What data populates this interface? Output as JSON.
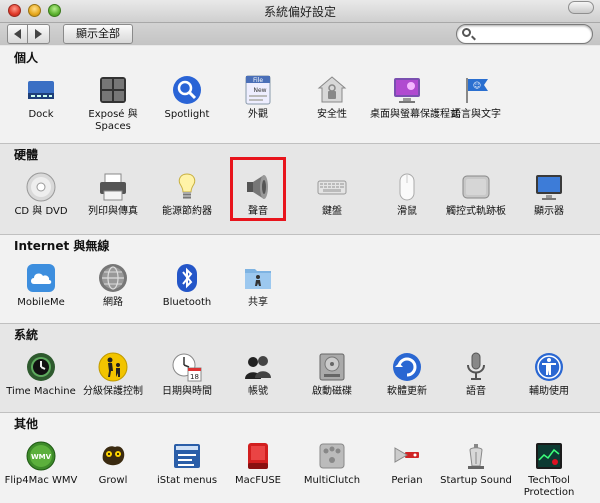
{
  "window": {
    "title": "系統偏好設定"
  },
  "toolbar": {
    "show_all": "顯示全部",
    "search_placeholder": ""
  },
  "sections": [
    {
      "title": "個人",
      "items": [
        {
          "label": "Dock",
          "icon": "dock-icon"
        },
        {
          "label": "Exposé 與 Spaces",
          "icon": "expose-spaces-icon"
        },
        {
          "label": "Spotlight",
          "icon": "spotlight-icon"
        },
        {
          "label": "外觀",
          "icon": "appearance-icon"
        },
        {
          "label": "安全性",
          "icon": "security-icon"
        },
        {
          "label": "桌面與螢幕保護程式",
          "icon": "desktop-screensaver-icon"
        },
        {
          "label": "語言與文字",
          "icon": "language-text-icon"
        }
      ]
    },
    {
      "title": "硬體",
      "items": [
        {
          "label": "CD 與 DVD",
          "icon": "cd-dvd-icon"
        },
        {
          "label": "列印與傳真",
          "icon": "print-fax-icon"
        },
        {
          "label": "能源節約器",
          "icon": "energy-saver-icon"
        },
        {
          "label": "聲音",
          "icon": "sound-icon"
        },
        {
          "label": "鍵盤",
          "icon": "keyboard-icon"
        },
        {
          "label": "滑鼠",
          "icon": "mouse-icon"
        },
        {
          "label": "觸控式軌跡板",
          "icon": "trackpad-icon"
        },
        {
          "label": "顯示器",
          "icon": "displays-icon"
        }
      ]
    },
    {
      "title": "Internet 與無線",
      "items": [
        {
          "label": "MobileMe",
          "icon": "mobileme-icon"
        },
        {
          "label": "網路",
          "icon": "network-icon"
        },
        {
          "label": "Bluetooth",
          "icon": "bluetooth-icon"
        },
        {
          "label": "共享",
          "icon": "sharing-icon"
        }
      ]
    },
    {
      "title": "系統",
      "items": [
        {
          "label": "Time Machine",
          "icon": "time-machine-icon"
        },
        {
          "label": "分級保護控制",
          "icon": "parental-controls-icon"
        },
        {
          "label": "日期與時間",
          "icon": "date-time-icon"
        },
        {
          "label": "帳號",
          "icon": "accounts-icon"
        },
        {
          "label": "啟動磁碟",
          "icon": "startup-disk-icon"
        },
        {
          "label": "軟體更新",
          "icon": "software-update-icon"
        },
        {
          "label": "語音",
          "icon": "speech-icon"
        },
        {
          "label": "輔助使用",
          "icon": "universal-access-icon"
        }
      ]
    },
    {
      "title": "其他",
      "items": [
        {
          "label": "Flip4Mac WMV",
          "icon": "flip4mac-wmv-icon",
          "badge": "WMV"
        },
        {
          "label": "Growl",
          "icon": "growl-icon"
        },
        {
          "label": "iStat menus",
          "icon": "istat-menus-icon"
        },
        {
          "label": "MacFUSE",
          "icon": "macfuse-icon"
        },
        {
          "label": "MultiClutch",
          "icon": "multiclutch-icon"
        },
        {
          "label": "Perian",
          "icon": "perian-icon"
        },
        {
          "label": "Startup Sound",
          "icon": "startup-sound-icon"
        },
        {
          "label": "TechTool Protection",
          "icon": "techtool-protection-icon"
        }
      ]
    }
  ],
  "highlight": {
    "section": 1,
    "item": 3,
    "color": "#e8141c"
  },
  "icon_glyphs": {
    "appearance-top": "File",
    "appearance-mid": "New",
    "date-day": "18"
  }
}
